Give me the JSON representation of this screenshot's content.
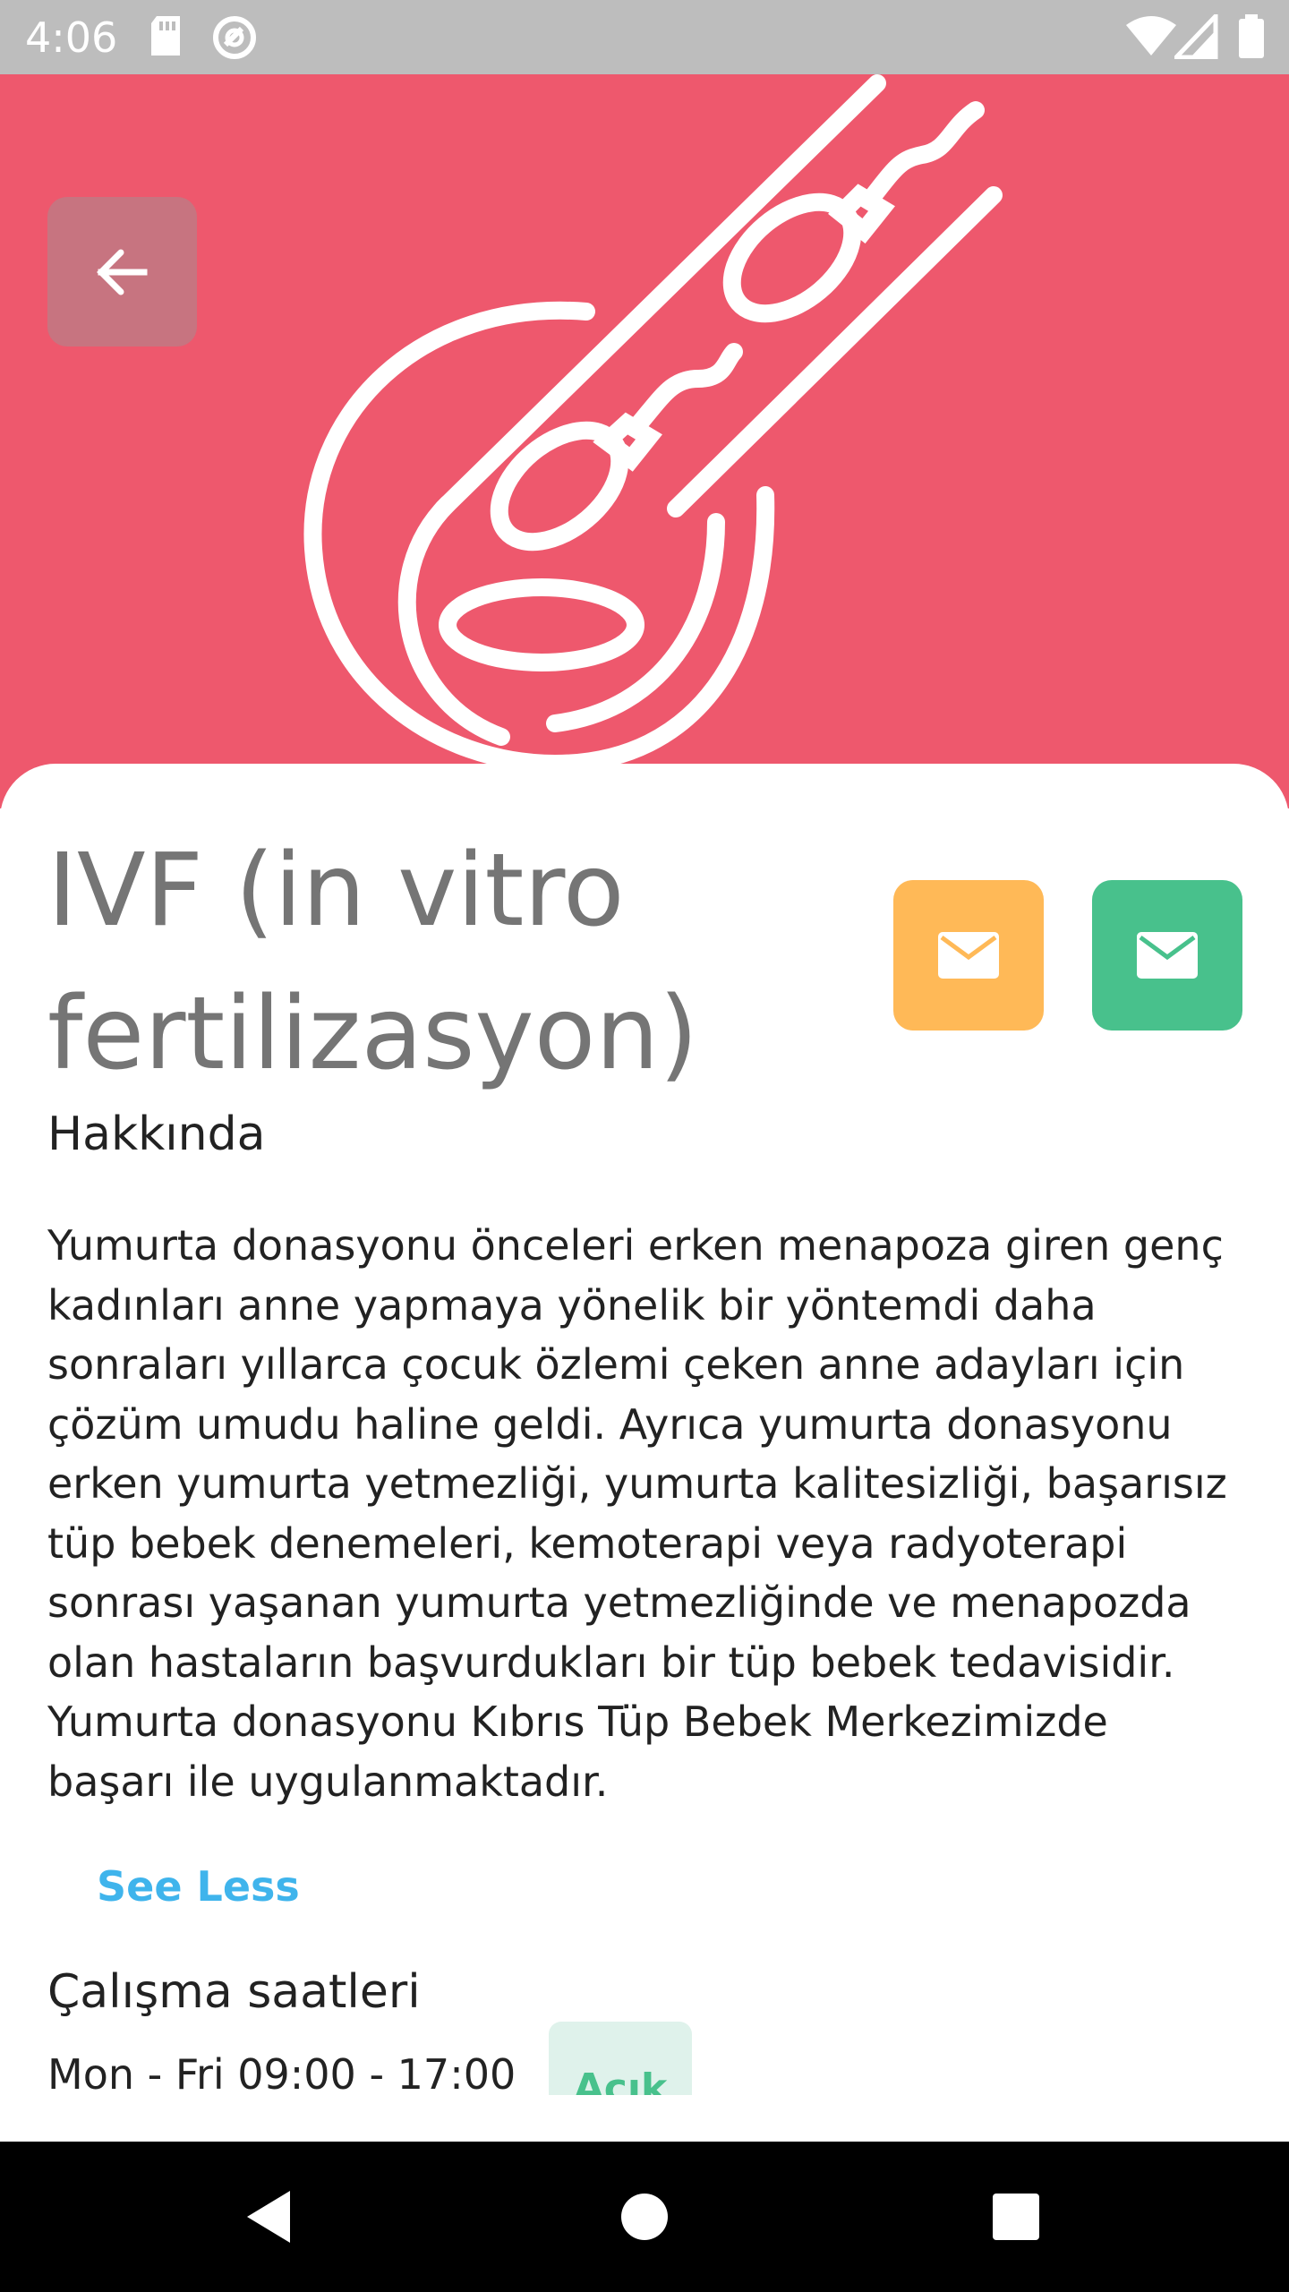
{
  "status_bar": {
    "time": "4:06",
    "icons": [
      "sd-card-icon",
      "sync-icon",
      "wifi-icon",
      "signal-icon",
      "battery-icon"
    ]
  },
  "hero": {
    "background_color": "#ee586d",
    "illustration": "ivf-petri-dish-icon",
    "back_icon": "arrow-left-icon"
  },
  "title": "IVF (in vitro fertilizasyon)",
  "actions": [
    {
      "icon": "mail-icon",
      "color": "#ffb957"
    },
    {
      "icon": "mail-icon",
      "color": "#48c18c"
    }
  ],
  "about": {
    "label": "Hakkında",
    "text": "Yumurta donasyonu önceleri erken menapoza giren genç kadınları anne yapmaya yönelik bir yöntemdi daha sonraları yıllarca çocuk özlemi çeken anne adayları için çözüm umudu haline geldi. Ayrıca yumurta donasyonu erken yumurta yetmezliği, yumurta kalitesizliği, başarısız tüp bebek denemeleri, kemoterapi veya radyoterapi sonrası yaşanan yumurta yetmezliğinde ve menapozda olan hastaların başvurdukları bir tüp bebek tedavisidir. Yumurta donasyonu Kıbrıs Tüp Bebek Merkezimizde başarı ile uygulanmaktadır.",
    "toggle_label": "See Less"
  },
  "hours": {
    "label": "Çalışma saatleri",
    "value": "Mon - Fri 09:00 - 17:00",
    "status": "Açık"
  },
  "nav": {
    "icons": [
      "back-triangle-icon",
      "home-circle-icon",
      "recents-square-icon"
    ]
  }
}
